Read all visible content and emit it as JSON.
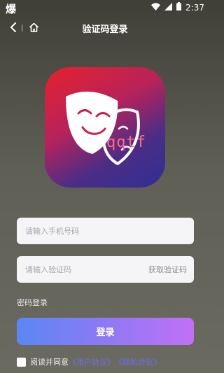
{
  "status_bar": {
    "left_glyph": "爆",
    "time": "2:37"
  },
  "nav": {
    "title": "验证码登录"
  },
  "logo": {
    "text": "qqtf"
  },
  "phone_input": {
    "placeholder": "请输入手机号码",
    "value": ""
  },
  "code_input": {
    "placeholder": "请输入验证码",
    "value": "",
    "get_code_label": "获取验证码"
  },
  "password_login_label": "密码登录",
  "login_button_label": "登录",
  "agreement": {
    "prefix": "阅读并同意",
    "user_agreement": "《用户协议》",
    "privacy_agreement": "《隐私协议》"
  },
  "colors": {
    "login_gradient_start": "#5a87f4",
    "login_gradient_end": "#c070f7",
    "link": "#6f6cf5"
  }
}
